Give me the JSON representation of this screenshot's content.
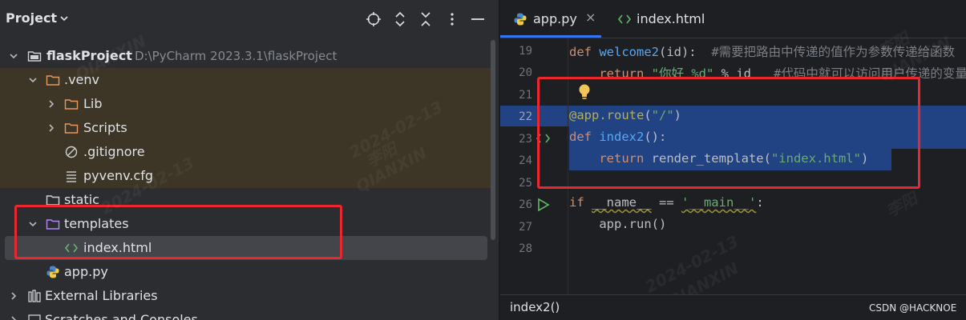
{
  "project": {
    "title": "Project",
    "tree": [
      {
        "label": "flaskProject",
        "path": "D:\\PyCharm 2023.3.1\\flaskProject"
      },
      {
        "label": ".venv"
      },
      {
        "label": "Lib"
      },
      {
        "label": "Scripts"
      },
      {
        "label": ".gitignore"
      },
      {
        "label": "pyvenv.cfg"
      },
      {
        "label": "static"
      },
      {
        "label": "templates"
      },
      {
        "label": "index.html"
      },
      {
        "label": "app.py"
      },
      {
        "label": "External Libraries"
      },
      {
        "label": "Scratches and Consoles"
      }
    ]
  },
  "editor": {
    "tabs": [
      {
        "label": "app.py",
        "close": "×"
      },
      {
        "label": "index.html"
      }
    ],
    "line_numbers": [
      "19",
      "20",
      "21",
      "22",
      "23",
      "24",
      "25",
      "26",
      "27",
      "28"
    ],
    "code": {
      "l19": {
        "kw": "def ",
        "fn": "welcome2",
        "rest": "(id):  ",
        "cmt": "#需要把路由中传递的值作为参数传递给函数"
      },
      "l20": {
        "indent": "    ",
        "kw": "return ",
        "str": "\"你好 %d\"",
        "rest": " % id   ",
        "cmt": "#代码中就可以访问用户传递的变量"
      },
      "l22": {
        "dec": "@app.route",
        "rest1": "(",
        "str": "\"/\"",
        "rest2": ")"
      },
      "l23": {
        "kw": "def ",
        "fn": "index2",
        "rest": "():"
      },
      "l24": {
        "indent": "    ",
        "kw": "return ",
        "plain": "render_template(",
        "str": "\"index.html\"",
        "rest": ")"
      },
      "l26": {
        "kw": "if ",
        "name": "__name__",
        "op": " == ",
        "str": "'__main__'",
        "rest": ":"
      },
      "l27": {
        "indent": "    ",
        "plain": "app.run()"
      }
    },
    "breadcrumb": "index2()",
    "credit": "CSDN @HACKNOE"
  },
  "watermark": {
    "date": "2024-02-13",
    "name": "李阳",
    "company": "QIANXIN"
  },
  "colors": {
    "accent": "#3574f0",
    "highlight": "#214283",
    "annotation_box": "#e8282e",
    "venv_bg": "#3d3525"
  }
}
